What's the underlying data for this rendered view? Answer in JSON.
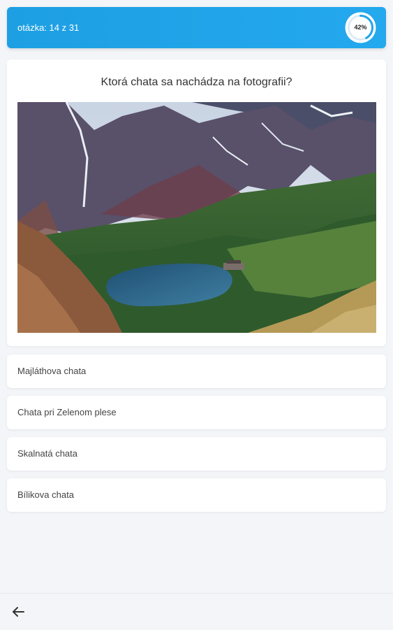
{
  "header": {
    "question_counter": "otázka: 14 z 31",
    "progress_label": "42%",
    "progress_fraction": 0.42,
    "accent_color": "#22a5ec"
  },
  "question": {
    "text": "Ktorá chata sa nachádza na fotografii?",
    "image_icon": "mountain-lake-photo"
  },
  "answers": [
    {
      "label": "Majláthova chata"
    },
    {
      "label": "Chata pri Zelenom plese"
    },
    {
      "label": "Skalnatá chata"
    },
    {
      "label": "Bílikova chata"
    }
  ],
  "footer": {
    "back_icon": "arrow-left-icon"
  }
}
